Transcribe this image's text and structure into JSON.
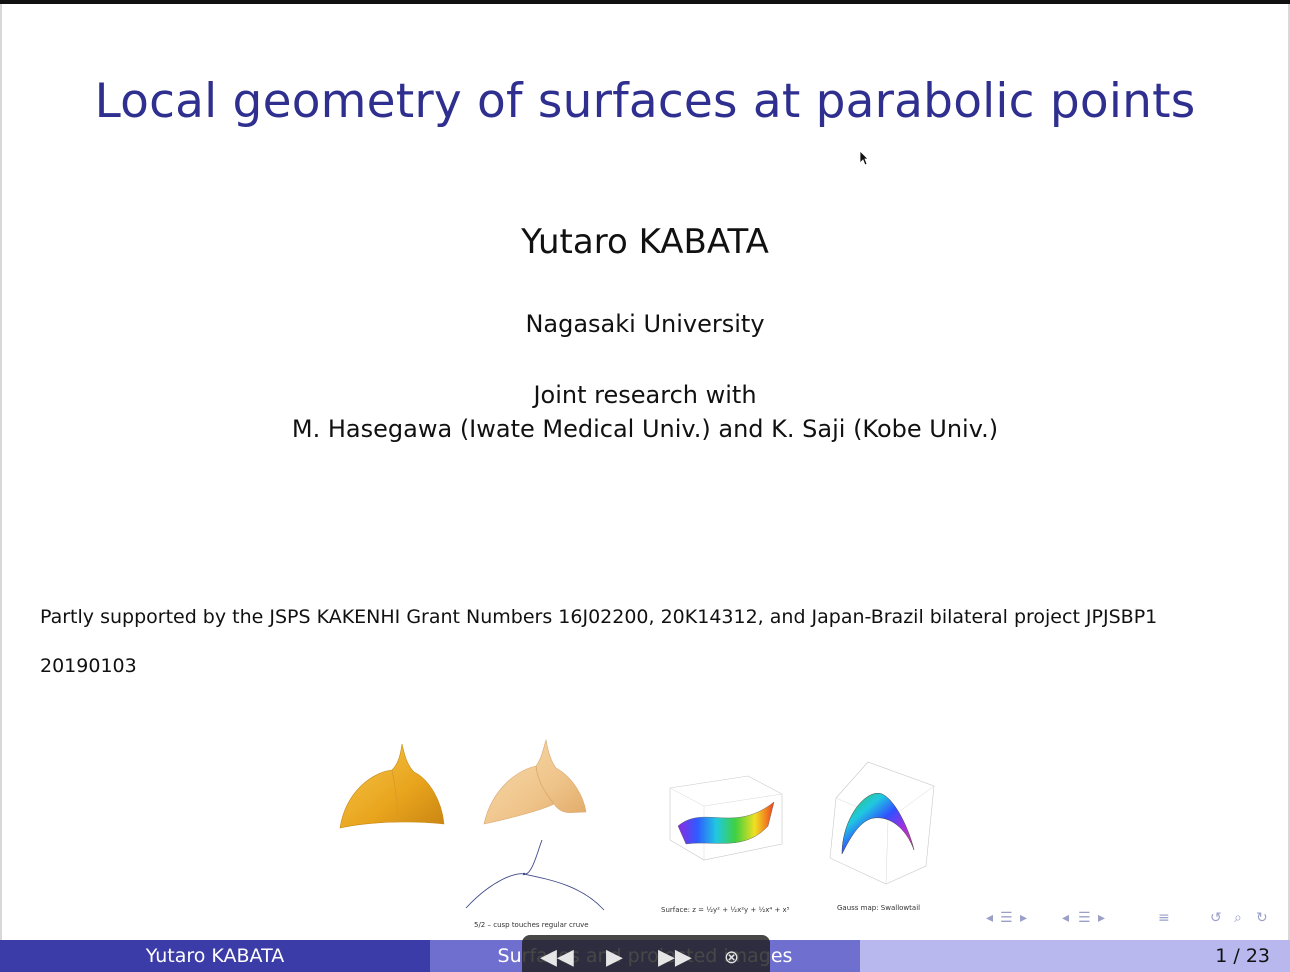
{
  "slide": {
    "title": "Local geometry of surfaces at parabolic points",
    "author": "Yutaro KABATA",
    "affiliation": "Nagasaki University",
    "joint_line1": "Joint research with",
    "joint_line2": "M. Hasegawa (Iwate Medical Univ.) and K. Saji (Kobe Univ.)",
    "support": "Partly supported by the JSPS KAKENHI Grant Numbers 16J02200, 20K14312, and Japan-Brazil bilateral project JPJSBP1",
    "date_code": "20190103"
  },
  "figures": {
    "caption_cusp": "5/2 – cusp touches regular cruve",
    "caption_surface": "Surface: z = ½y² + ½x²y + ½x⁴ + x⁵",
    "caption_gauss": "Gauss map: Swallowtail"
  },
  "footer": {
    "author": "Yutaro KABATA",
    "short_title": "Surfaces and projected images",
    "page": "1 / 23"
  },
  "colors": {
    "title": "#2f2f8f",
    "footer_left": "#3c3ca8",
    "footer_mid": "#6f6fd0",
    "footer_right": "#b8b8ee"
  },
  "icons": {
    "nav": [
      "frame-prev-icon",
      "frame-next-icon",
      "section-prev-icon",
      "section-next-icon",
      "toc-icon",
      "undo-icon",
      "search-icon",
      "redo-icon"
    ],
    "player": [
      "rewind-icon",
      "play-icon",
      "fast-forward-icon",
      "close-icon"
    ]
  }
}
